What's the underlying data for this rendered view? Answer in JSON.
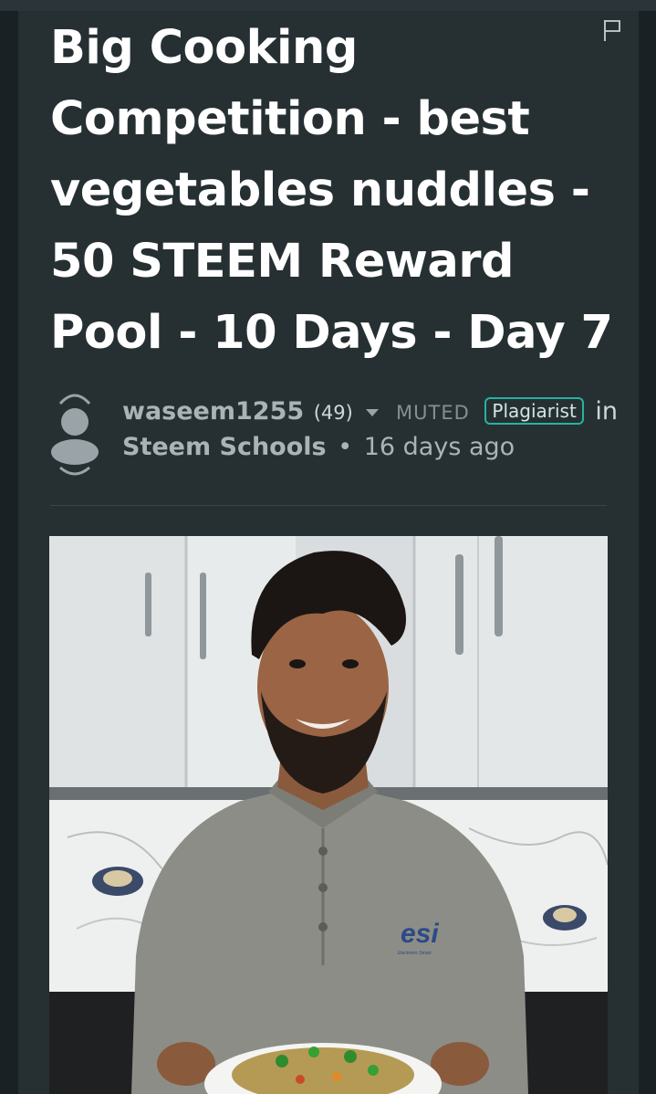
{
  "post": {
    "title": "Big Cooking Competition - best vegetables nuddles - 50 STEEM Reward Pool - 10 Days - Day 7",
    "author": "waseem1255",
    "reputation": "(49)",
    "muted_label": "MUTED",
    "badge": "Plagiarist",
    "in_word": "in",
    "community": "Steem Schools",
    "separator": "•",
    "time_ago": "16 days ago"
  },
  "photo": {
    "shirt_logo": "esi",
    "shirt_logo_sub": "Electronic Smart"
  },
  "icons": {
    "flag": "flag-icon",
    "avatar": "avatar-placeholder-icon",
    "caret": "caret-down-icon"
  },
  "colors": {
    "background": "#1c2428",
    "card": "#263033",
    "title": "#ffffff",
    "meta_text": "#aab4b8",
    "badge_border": "#26b39f"
  }
}
